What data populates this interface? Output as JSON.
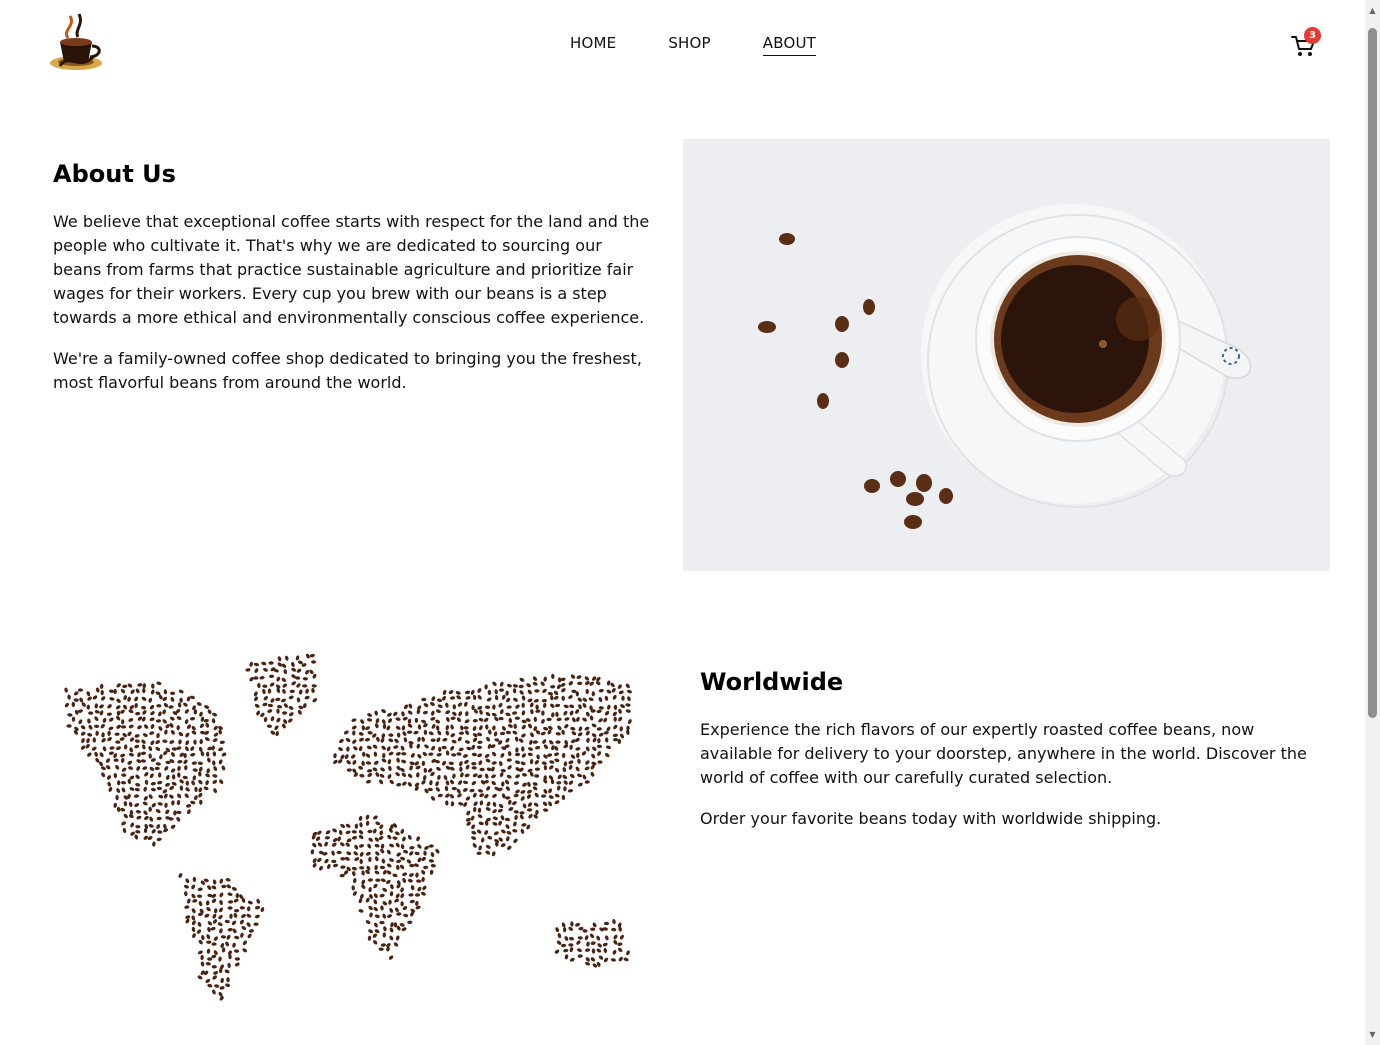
{
  "nav": {
    "items": [
      {
        "label": "HOME",
        "active": false
      },
      {
        "label": "SHOP",
        "active": false
      },
      {
        "label": "ABOUT",
        "active": true
      }
    ]
  },
  "cart": {
    "count": "3",
    "icon": "cart-icon",
    "badge_color": "#e53935"
  },
  "about": {
    "title": "About Us",
    "paragraphs": [
      "We believe that exceptional coffee starts with respect for the land and the people who cultivate it. That's why we are dedicated to sourcing our beans from farms that practice sustainable agriculture and prioritize fair wages for their workers. Every cup you brew with our beans is a step towards a more ethical and environmentally conscious coffee experience.",
      "We're a family-owned coffee shop dedicated to bringing you the freshest, most flavorful beans from around the world."
    ]
  },
  "worldwide": {
    "title": "Worldwide",
    "paragraphs": [
      "Experience the rich flavors of our expertly roasted coffee beans, now available for delivery to your doorstep, anywhere in the world. Discover the world of coffee with our carefully curated selection.",
      "Order your favorite beans today with worldwide shipping."
    ]
  },
  "colors": {
    "bean": "#4a2412",
    "coffee": "#3b1d0e",
    "photo_bg": "#eceef1"
  }
}
